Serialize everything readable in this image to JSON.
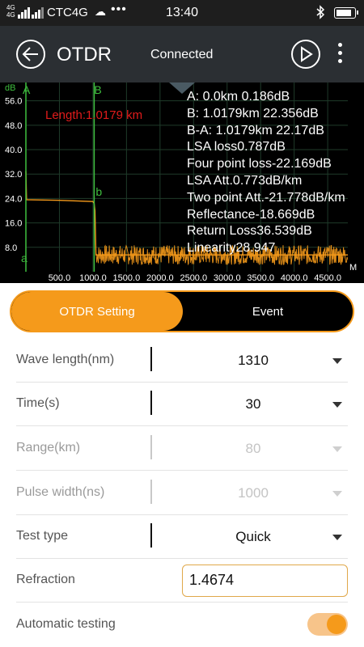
{
  "status_bar": {
    "signal_top": "4G",
    "signal_bottom": "4G",
    "carrier": "CTC4G",
    "weather_icon": "cloud-icon",
    "overflow": "•••",
    "time": "13:40",
    "bluetooth_icon": "bluetooth-icon",
    "battery_level": 0.9
  },
  "header": {
    "title": "OTDR",
    "connection_status": "Connected",
    "back_icon": "back-arrow-icon",
    "play_icon": "play-icon",
    "more_icon": "more-vert-icon"
  },
  "trace_info": [
    "A: 0.0km 0.186dB",
    "B: 1.0179km 22.356dB",
    "B-A: 1.0179km 22.17dB",
    "LSA loss0.787dB",
    "Four point loss-22.169dB",
    "LSA Att.0.773dB/km",
    "Two point Att.-21.778dB/km",
    "Reflectance-18.669dB",
    "Return Loss36.539dB",
    "Linearity28.947"
  ],
  "chart_data": {
    "type": "line",
    "xlabel": "M",
    "ylabel": "dB",
    "xlim": [
      0,
      4800
    ],
    "ylim": [
      0,
      62
    ],
    "x_ticks": [
      "500.0",
      "1000.0",
      "1500.0",
      "2000.0",
      "2500.0",
      "3000.0",
      "3500.0",
      "4000.0",
      "4500.0"
    ],
    "x_tick_values": [
      500,
      1000,
      1500,
      2000,
      2500,
      3000,
      3500,
      4000,
      4500
    ],
    "y_ticks": [
      "8.0",
      "16.0",
      "24.0",
      "32.0",
      "40.0",
      "48.0",
      "56.0"
    ],
    "y_tick_values": [
      8,
      16,
      24,
      32,
      40,
      48,
      56
    ],
    "grid": true,
    "length_label": "Length:1.0179 km",
    "series": [
      {
        "color": "#f59a1b",
        "points": [
          [
            0,
            33
          ],
          [
            10,
            23.6
          ],
          [
            500,
            23.4
          ],
          [
            1000,
            23.0
          ],
          [
            1018,
            22.4
          ],
          [
            1030,
            20.0
          ],
          [
            1045,
            5.5
          ],
          [
            4800,
            5.5
          ]
        ],
        "noise_from": 1045,
        "noise_amplitude": 3.2
      }
    ],
    "markers": [
      {
        "name": "A",
        "lower": "a",
        "x": 0,
        "color": "#3fbf3f"
      },
      {
        "name": "B",
        "lower": "b",
        "x": 1018,
        "color": "#3fbf3f"
      }
    ],
    "colors": {
      "background": "#000000",
      "grid": "#1f3b2a",
      "tick_label": "#ffffff",
      "length_label": "#e11b1b",
      "axis": "#3fbf3f"
    }
  },
  "tabs": {
    "setting_label": "OTDR Setting",
    "event_label": "Event",
    "active": "setting"
  },
  "settings": {
    "wavelength": {
      "label": "Wave length(nm)",
      "value": "1310"
    },
    "time": {
      "label": "Time(s)",
      "value": "30"
    },
    "range": {
      "label": "Range(km)",
      "value": "80"
    },
    "pulse": {
      "label": "Pulse width(ns)",
      "value": "1000"
    },
    "test_type": {
      "label": "Test type",
      "value": "Quick"
    },
    "refraction": {
      "label": "Refraction",
      "value": "1.4674"
    },
    "auto_test": {
      "label": "Automatic testing",
      "enabled": true
    }
  },
  "colors": {
    "accent": "#f59a1b",
    "header_bg": "#2b2f33",
    "status_bg": "#1e1e1e"
  }
}
